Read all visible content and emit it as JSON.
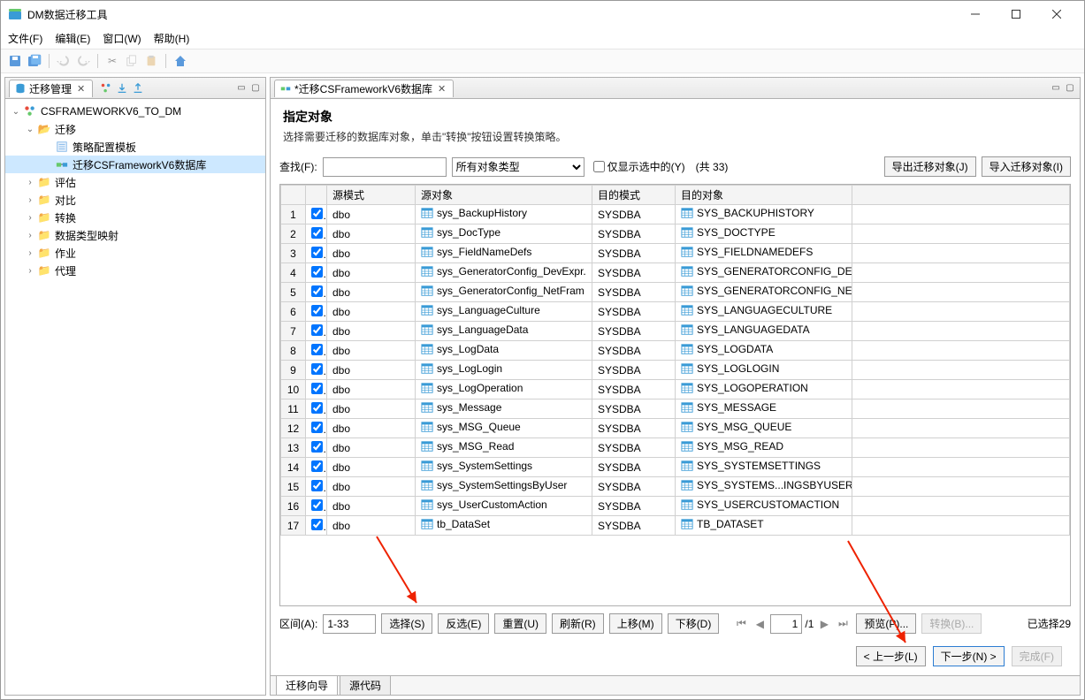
{
  "window": {
    "title": "DM数据迁移工具"
  },
  "menu": {
    "file": "文件(F)",
    "edit": "编辑(E)",
    "window": "窗口(W)",
    "help": "帮助(H)"
  },
  "leftPanel": {
    "tab": "迁移管理",
    "tree": {
      "root": "CSFRAMEWORKV6_TO_DM",
      "migration": "迁移",
      "templates": "策略配置模板",
      "migrateDb": "迁移CSFrameworkV6数据库",
      "evaluate": "评估",
      "compare": "对比",
      "convert": "转换",
      "typeMap": "数据类型映射",
      "jobs": "作业",
      "agent": "代理"
    }
  },
  "rightPanel": {
    "tab": "*迁移CSFrameworkV6数据库",
    "heading": "指定对象",
    "desc": "选择需要迁移的数据库对象，单击\"转换\"按钮设置转换策略。",
    "search": {
      "label": "查找(F):",
      "typeAll": "所有对象类型",
      "onlySelected": "仅显示选中的(Y)",
      "totalPrefix": "(共 ",
      "total": 33,
      "totalSuffix": ")"
    },
    "buttons": {
      "export": "导出迁移对象(J)",
      "import": "导入迁移对象(I)"
    },
    "columns": {
      "srcSchema": "源模式",
      "srcObj": "源对象",
      "dstSchema": "目的模式",
      "dstObj": "目的对象"
    },
    "rows": [
      {
        "n": 1,
        "ss": "dbo",
        "so": "sys_BackupHistory",
        "ds": "SYSDBA",
        "do_": "SYS_BACKUPHISTORY"
      },
      {
        "n": 2,
        "ss": "dbo",
        "so": "sys_DocType",
        "ds": "SYSDBA",
        "do_": "SYS_DOCTYPE"
      },
      {
        "n": 3,
        "ss": "dbo",
        "so": "sys_FieldNameDefs",
        "ds": "SYSDBA",
        "do_": "SYS_FIELDNAMEDEFS"
      },
      {
        "n": 4,
        "ss": "dbo",
        "so": "sys_GeneratorConfig_DevExpr.",
        "ds": "SYSDBA",
        "do_": "SYS_GENERATORCONFIG_DEV"
      },
      {
        "n": 5,
        "ss": "dbo",
        "so": "sys_GeneratorConfig_NetFram",
        "ds": "SYSDBA",
        "do_": "SYS_GENERATORCONFIG_NET"
      },
      {
        "n": 6,
        "ss": "dbo",
        "so": "sys_LanguageCulture",
        "ds": "SYSDBA",
        "do_": "SYS_LANGUAGECULTURE"
      },
      {
        "n": 7,
        "ss": "dbo",
        "so": "sys_LanguageData",
        "ds": "SYSDBA",
        "do_": "SYS_LANGUAGEDATA"
      },
      {
        "n": 8,
        "ss": "dbo",
        "so": "sys_LogData",
        "ds": "SYSDBA",
        "do_": "SYS_LOGDATA"
      },
      {
        "n": 9,
        "ss": "dbo",
        "so": "sys_LogLogin",
        "ds": "SYSDBA",
        "do_": "SYS_LOGLOGIN"
      },
      {
        "n": 10,
        "ss": "dbo",
        "so": "sys_LogOperation",
        "ds": "SYSDBA",
        "do_": "SYS_LOGOPERATION"
      },
      {
        "n": 11,
        "ss": "dbo",
        "so": "sys_Message",
        "ds": "SYSDBA",
        "do_": "SYS_MESSAGE"
      },
      {
        "n": 12,
        "ss": "dbo",
        "so": "sys_MSG_Queue",
        "ds": "SYSDBA",
        "do_": "SYS_MSG_QUEUE"
      },
      {
        "n": 13,
        "ss": "dbo",
        "so": "sys_MSG_Read",
        "ds": "SYSDBA",
        "do_": "SYS_MSG_READ"
      },
      {
        "n": 14,
        "ss": "dbo",
        "so": "sys_SystemSettings",
        "ds": "SYSDBA",
        "do_": "SYS_SYSTEMSETTINGS"
      },
      {
        "n": 15,
        "ss": "dbo",
        "so": "sys_SystemSettingsByUser",
        "ds": "SYSDBA",
        "do_": "SYS_SYSTEMS...INGSBYUSER"
      },
      {
        "n": 16,
        "ss": "dbo",
        "so": "sys_UserCustomAction",
        "ds": "SYSDBA",
        "do_": "SYS_USERCUSTOMACTION"
      },
      {
        "n": 17,
        "ss": "dbo",
        "so": "tb_DataSet",
        "ds": "SYSDBA",
        "do_": "TB_DATASET"
      }
    ],
    "rangeLabel": "区间(A):",
    "rangeVal": "1-33",
    "footerBtns": {
      "select": "选择(S)",
      "invert": "反选(E)",
      "reset": "重置(U)",
      "refresh": "刷新(R)",
      "moveUp": "上移(M)",
      "moveDown": "下移(D)",
      "preview": "预览(P)...",
      "convert": "转换(B)..."
    },
    "pager": {
      "page": "1",
      "total": "/1"
    },
    "selCountPrefix": "已选择",
    "selCount": 29,
    "nav": {
      "prev": "< 上一步(L)",
      "next": "下一步(N) >",
      "finish": "完成(F)"
    },
    "bottomTabs": {
      "wizard": "迁移向导",
      "source": "源代码"
    }
  }
}
